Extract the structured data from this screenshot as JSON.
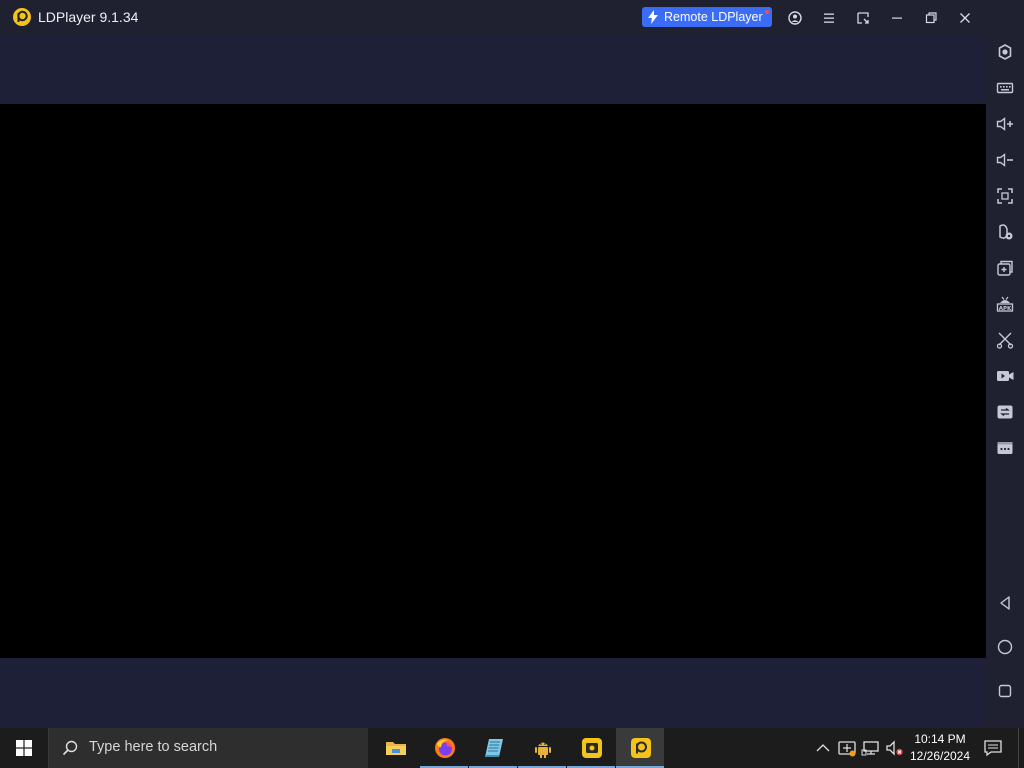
{
  "window": {
    "title": "LDPlayer 9.1.34",
    "remote_button_label": "Remote LDPlayer"
  },
  "title_bar_buttons": [
    {
      "name": "account-icon"
    },
    {
      "name": "menu-icon"
    },
    {
      "name": "resize-icon"
    },
    {
      "name": "minimize-icon"
    },
    {
      "name": "restore-icon"
    },
    {
      "name": "close-icon"
    },
    {
      "name": "collapse-sidebar-icon"
    }
  ],
  "toolbar": {
    "items": [
      {
        "name": "settings-icon"
      },
      {
        "name": "keyboard-icon"
      },
      {
        "name": "volume-up-icon"
      },
      {
        "name": "volume-down-icon"
      },
      {
        "name": "fullscreen-icon"
      },
      {
        "name": "operation-record-icon"
      },
      {
        "name": "multi-instance-icon"
      },
      {
        "name": "install-apk-icon"
      },
      {
        "name": "screenshot-scissors-icon"
      },
      {
        "name": "record-video-icon"
      },
      {
        "name": "sync-icon"
      },
      {
        "name": "more-icon"
      }
    ],
    "nav": [
      {
        "name": "android-back-icon"
      },
      {
        "name": "android-home-icon"
      },
      {
        "name": "android-recents-icon"
      }
    ]
  },
  "taskbar": {
    "search_placeholder": "Type here to search",
    "apps": [
      {
        "name": "file-explorer-icon",
        "active": false
      },
      {
        "name": "firefox-icon",
        "active": false
      },
      {
        "name": "notepad-icon",
        "active": false
      },
      {
        "name": "android-studio-icon",
        "active": false
      },
      {
        "name": "ldmultiplayer-icon",
        "active": false
      },
      {
        "name": "ldplayer-icon",
        "active": true
      }
    ],
    "clock": {
      "time": "10:14 PM",
      "date": "12/26/2024"
    }
  },
  "colors": {
    "title_bar": "#1f2131",
    "screen_band": "#1e2038",
    "screen": "#000000",
    "accent": "#3b6cf5",
    "taskbar": "#1c1c1c"
  }
}
